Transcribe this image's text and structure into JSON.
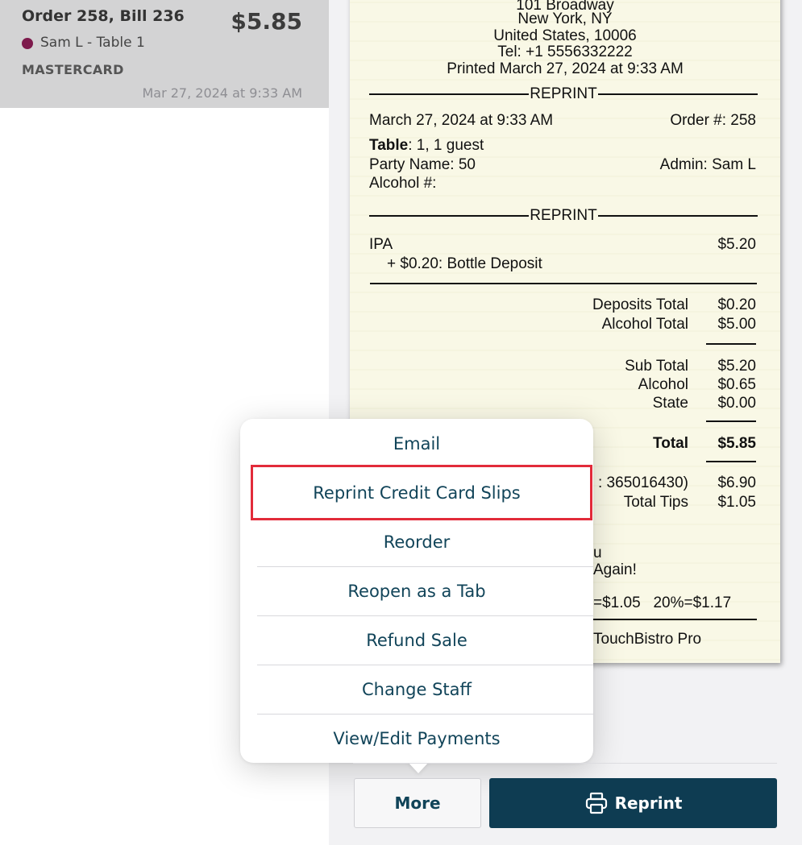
{
  "order_card": {
    "title": "Order 258, Bill 236",
    "total": "$5.85",
    "staff": "Sam L - Table 1",
    "payment_method": "MASTERCARD",
    "timestamp": "Mar 27, 2024 at 9:33 AM",
    "staff_dot_color": "#7d1a4c"
  },
  "receipt": {
    "header_lines": [
      "101 Broadway",
      "New York, NY",
      "United States, 10006",
      "Tel: +1 5556332222",
      "Printed March 27, 2024 at 9:33 AM"
    ],
    "reprint_label": "REPRINT",
    "date": "March 27, 2024 at 9:33 AM",
    "order_number": "Order #: 258",
    "table_label": "Table",
    "table_value": ": 1, 1 guest",
    "party_name": "Party Name: 50",
    "admin": "Admin: Sam L",
    "alcohol_number": "Alcohol #:",
    "item_name": "IPA",
    "item_price": "$5.20",
    "item_modifier": "+ $0.20: Bottle Deposit",
    "deposits_total_label": "Deposits Total",
    "deposits_total_value": "$0.20",
    "alcohol_total_label": "Alcohol Total",
    "alcohol_total_value": "$5.00",
    "sub_total_label": "Sub Total",
    "sub_total_value": "$5.20",
    "alcohol_tax_label": "Alcohol",
    "alcohol_tax_value": "$0.65",
    "state_tax_label": "State",
    "state_tax_value": "$0.00",
    "total_label": "Total",
    "total_value": "$5.85",
    "card_line_label": ": 365016430)",
    "card_line_value": "$6.90",
    "total_tips_label": "Total Tips",
    "total_tips_value": "$1.05",
    "thanks_line_1": "u",
    "thanks_line_2": "Again!",
    "tip_line": "=$1.05   20%=$1.17",
    "footer": "TouchBistro Pro"
  },
  "more_menu": {
    "items": [
      {
        "label": "Email"
      },
      {
        "label": "Reprint Credit Card Slips"
      },
      {
        "label": "Reorder"
      },
      {
        "label": "Reopen as a Tab"
      },
      {
        "label": "Refund Sale"
      },
      {
        "label": "Change Staff"
      },
      {
        "label": "View/Edit Payments"
      }
    ],
    "highlighted_item": "Reprint Credit Card Slips",
    "highlight_color": "#e22b3a",
    "text_color": "#114459"
  },
  "actions": {
    "more_label": "More",
    "reprint_label": "Reprint",
    "reprint_bg": "#0e3c52",
    "printer_icon": "printer-icon"
  }
}
